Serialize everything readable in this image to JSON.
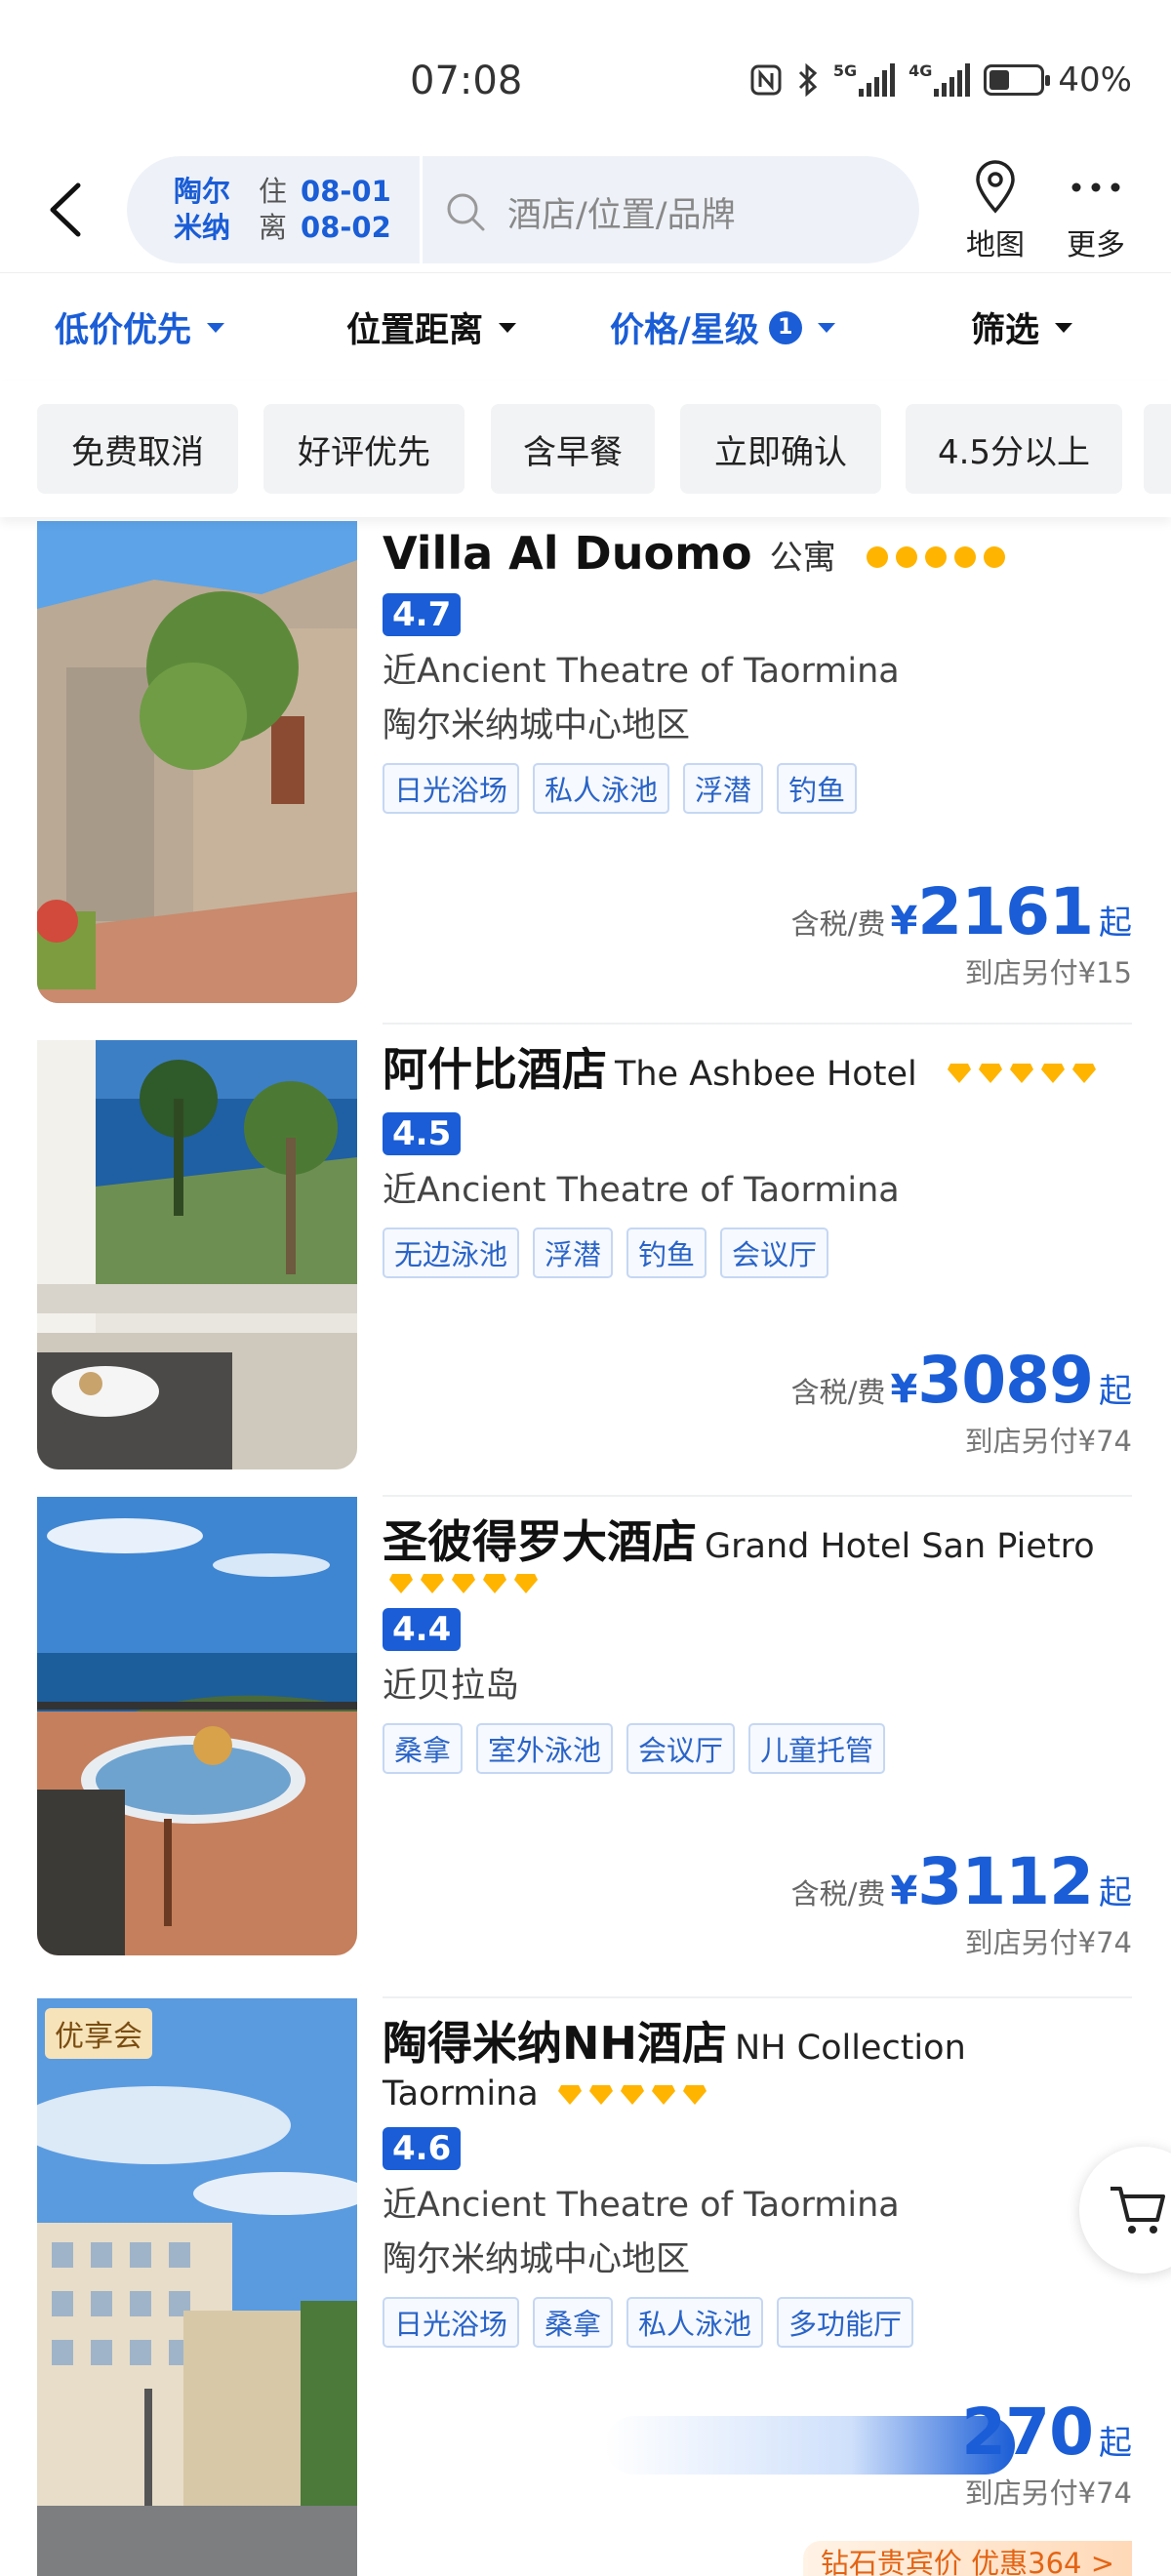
{
  "status_bar": {
    "time": "07:08",
    "battery": "40%",
    "battery_level": 0.4
  },
  "header": {
    "city": "陶尔\n米纳",
    "checkin_label": "住",
    "checkin": "08-01",
    "checkout_label": "离",
    "checkout": "08-02",
    "search_placeholder": "酒店/位置/品牌",
    "map_label": "地图",
    "more_label": "更多"
  },
  "sort": {
    "price_low": "低价优先",
    "distance": "位置距离",
    "price_star": "价格/星级",
    "price_star_count": "1",
    "filter": "筛选"
  },
  "chips": [
    "免费取消",
    "好评优先",
    "含早餐",
    "立即确认",
    "4.5分以上"
  ],
  "colors": {
    "accent": "#1a5dd6",
    "star": "#ffb400"
  },
  "hotels": [
    {
      "name": "Villa Al Duomo",
      "type": "公寓",
      "stars": 5,
      "star_shape": "circle",
      "score": "4.7",
      "near": "近Ancient Theatre of Taormina",
      "area": "陶尔米纳城中心地区",
      "tags": [
        "日光浴场",
        "私人泳池",
        "浮潜",
        "钓鱼"
      ],
      "price_prefix": "含税/费",
      "currency": "¥",
      "price": "2161",
      "price_suffix": "起",
      "extra": "到店另付¥15"
    },
    {
      "name": "阿什比酒店",
      "name_en": "The Ashbee Hotel",
      "stars": 5,
      "star_shape": "diamond",
      "score": "4.5",
      "near": "近Ancient Theatre of Taormina",
      "tags": [
        "无边泳池",
        "浮潜",
        "钓鱼",
        "会议厅"
      ],
      "price_prefix": "含税/费",
      "currency": "¥",
      "price": "3089",
      "price_suffix": "起",
      "extra": "到店另付¥74"
    },
    {
      "name": "圣彼得罗大酒店",
      "name_en": "Grand Hotel San Pietro",
      "stars": 5,
      "star_shape": "diamond",
      "score": "4.4",
      "near": "近贝拉岛",
      "tags": [
        "桑拿",
        "室外泳池",
        "会议厅",
        "儿童托管"
      ],
      "price_prefix": "含税/费",
      "currency": "¥",
      "price": "3112",
      "price_suffix": "起",
      "extra": "到店另付¥74"
    },
    {
      "badge": "优享会",
      "name": "陶得米纳NH酒店",
      "name_en": "NH Collection",
      "name_en2": "Taormina",
      "stars": 5,
      "star_shape": "diamond",
      "score": "4.6",
      "near": "近Ancient Theatre of Taormina",
      "area": "陶尔米纳城中心地区",
      "tags": [
        "日光浴场",
        "桑拿",
        "私人泳池",
        "多功能厅"
      ],
      "price": "270",
      "price_suffix": "起",
      "extra": "到店另付¥74",
      "promo": "钻石贵宾价  优惠364 >"
    }
  ]
}
